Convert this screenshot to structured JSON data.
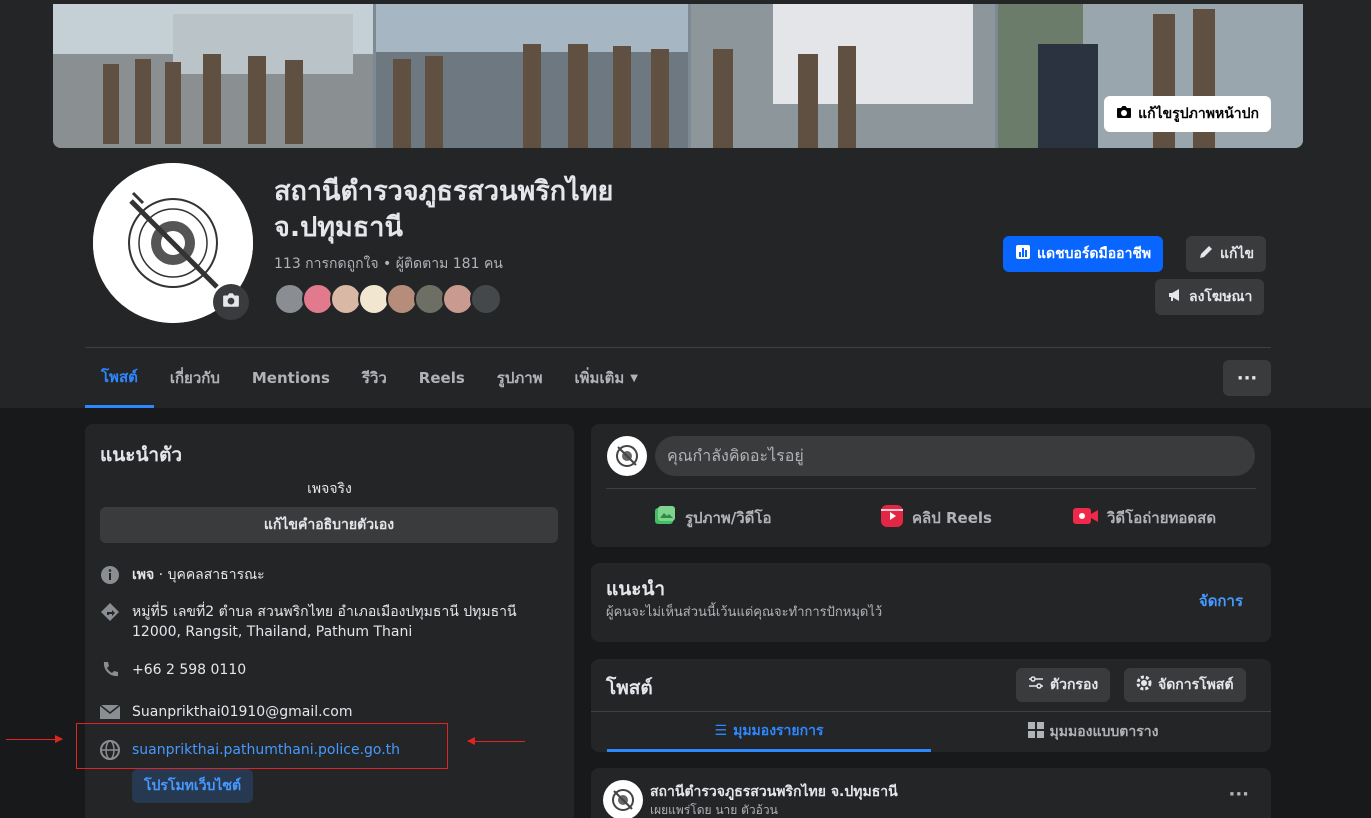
{
  "cover": {
    "edit_label": "แก้ไขรูปภาพหน้าปก"
  },
  "profile": {
    "name": "สถานีตำรวจภูธรสวนพริกไทย จ.ปทุมธานี",
    "stats": "113 การกดถูกใจ • ผู้ติดตาม 181 คน"
  },
  "actions": {
    "dashboard": "แดชบอร์ดมืออาชีพ",
    "edit": "แก้ไข",
    "advertise": "ลงโฆษณา"
  },
  "tabs": [
    {
      "label": "โพสต์"
    },
    {
      "label": "เกี่ยวกับ"
    },
    {
      "label": "Mentions"
    },
    {
      "label": "รีวิว"
    },
    {
      "label": "Reels"
    },
    {
      "label": "รูปภาพ"
    },
    {
      "label": "เพิ่มเติม"
    }
  ],
  "intro": {
    "title": "แนะนำตัว",
    "subtitle": "เพจจริง",
    "edit_bio": "แก้ไขคำอธิบายตัวเอง",
    "category_bold": "เพจ",
    "category_rest": " · บุคคลสาธารณะ",
    "address_line1": "หมู่ที่5 เลขที่2 ตำบล สวนพริกไทย อำเภอเมืองปทุมธานี ปทุมธานี",
    "address_line2": "12000, Rangsit, Thailand, Pathum Thani",
    "phone": "+66 2 598 0110",
    "email": "Suanprikthai01910@gmail.com",
    "website": "suanprikthai.pathumthani.police.go.th",
    "promote": "โปรโมทเว็บไซต์"
  },
  "composer": {
    "placeholder": "คุณกำลังคิดอะไรอยู่",
    "photo": "รูปภาพ/วิดีโอ",
    "reels": "คลิป Reels",
    "live": "วิดีโอถ่ายทอดสด"
  },
  "suggest": {
    "title": "แนะนำ",
    "subtitle": "ผู้คนจะไม่เห็นส่วนนี้เว้นแต่คุณจะทำการปักหมุดไว้",
    "manage": "จัดการ"
  },
  "posts": {
    "title": "โพสต์",
    "filter": "ตัวกรอง",
    "manage": "จัดการโพสต์",
    "list_view": "มุมมองรายการ",
    "grid_view": "มุมมองแบบตาราง"
  },
  "post": {
    "author": "สถานีตำรวจภูธรสวนพริกไทย จ.ปทุมธานี",
    "published_by": "เผยแพร่โดย นาย ตัวอ้วน"
  },
  "colors": {
    "background": "#18191a",
    "surface": "#242526",
    "accent": "#0866ff",
    "link": "#4599ff",
    "highlight": "#e02424"
  }
}
